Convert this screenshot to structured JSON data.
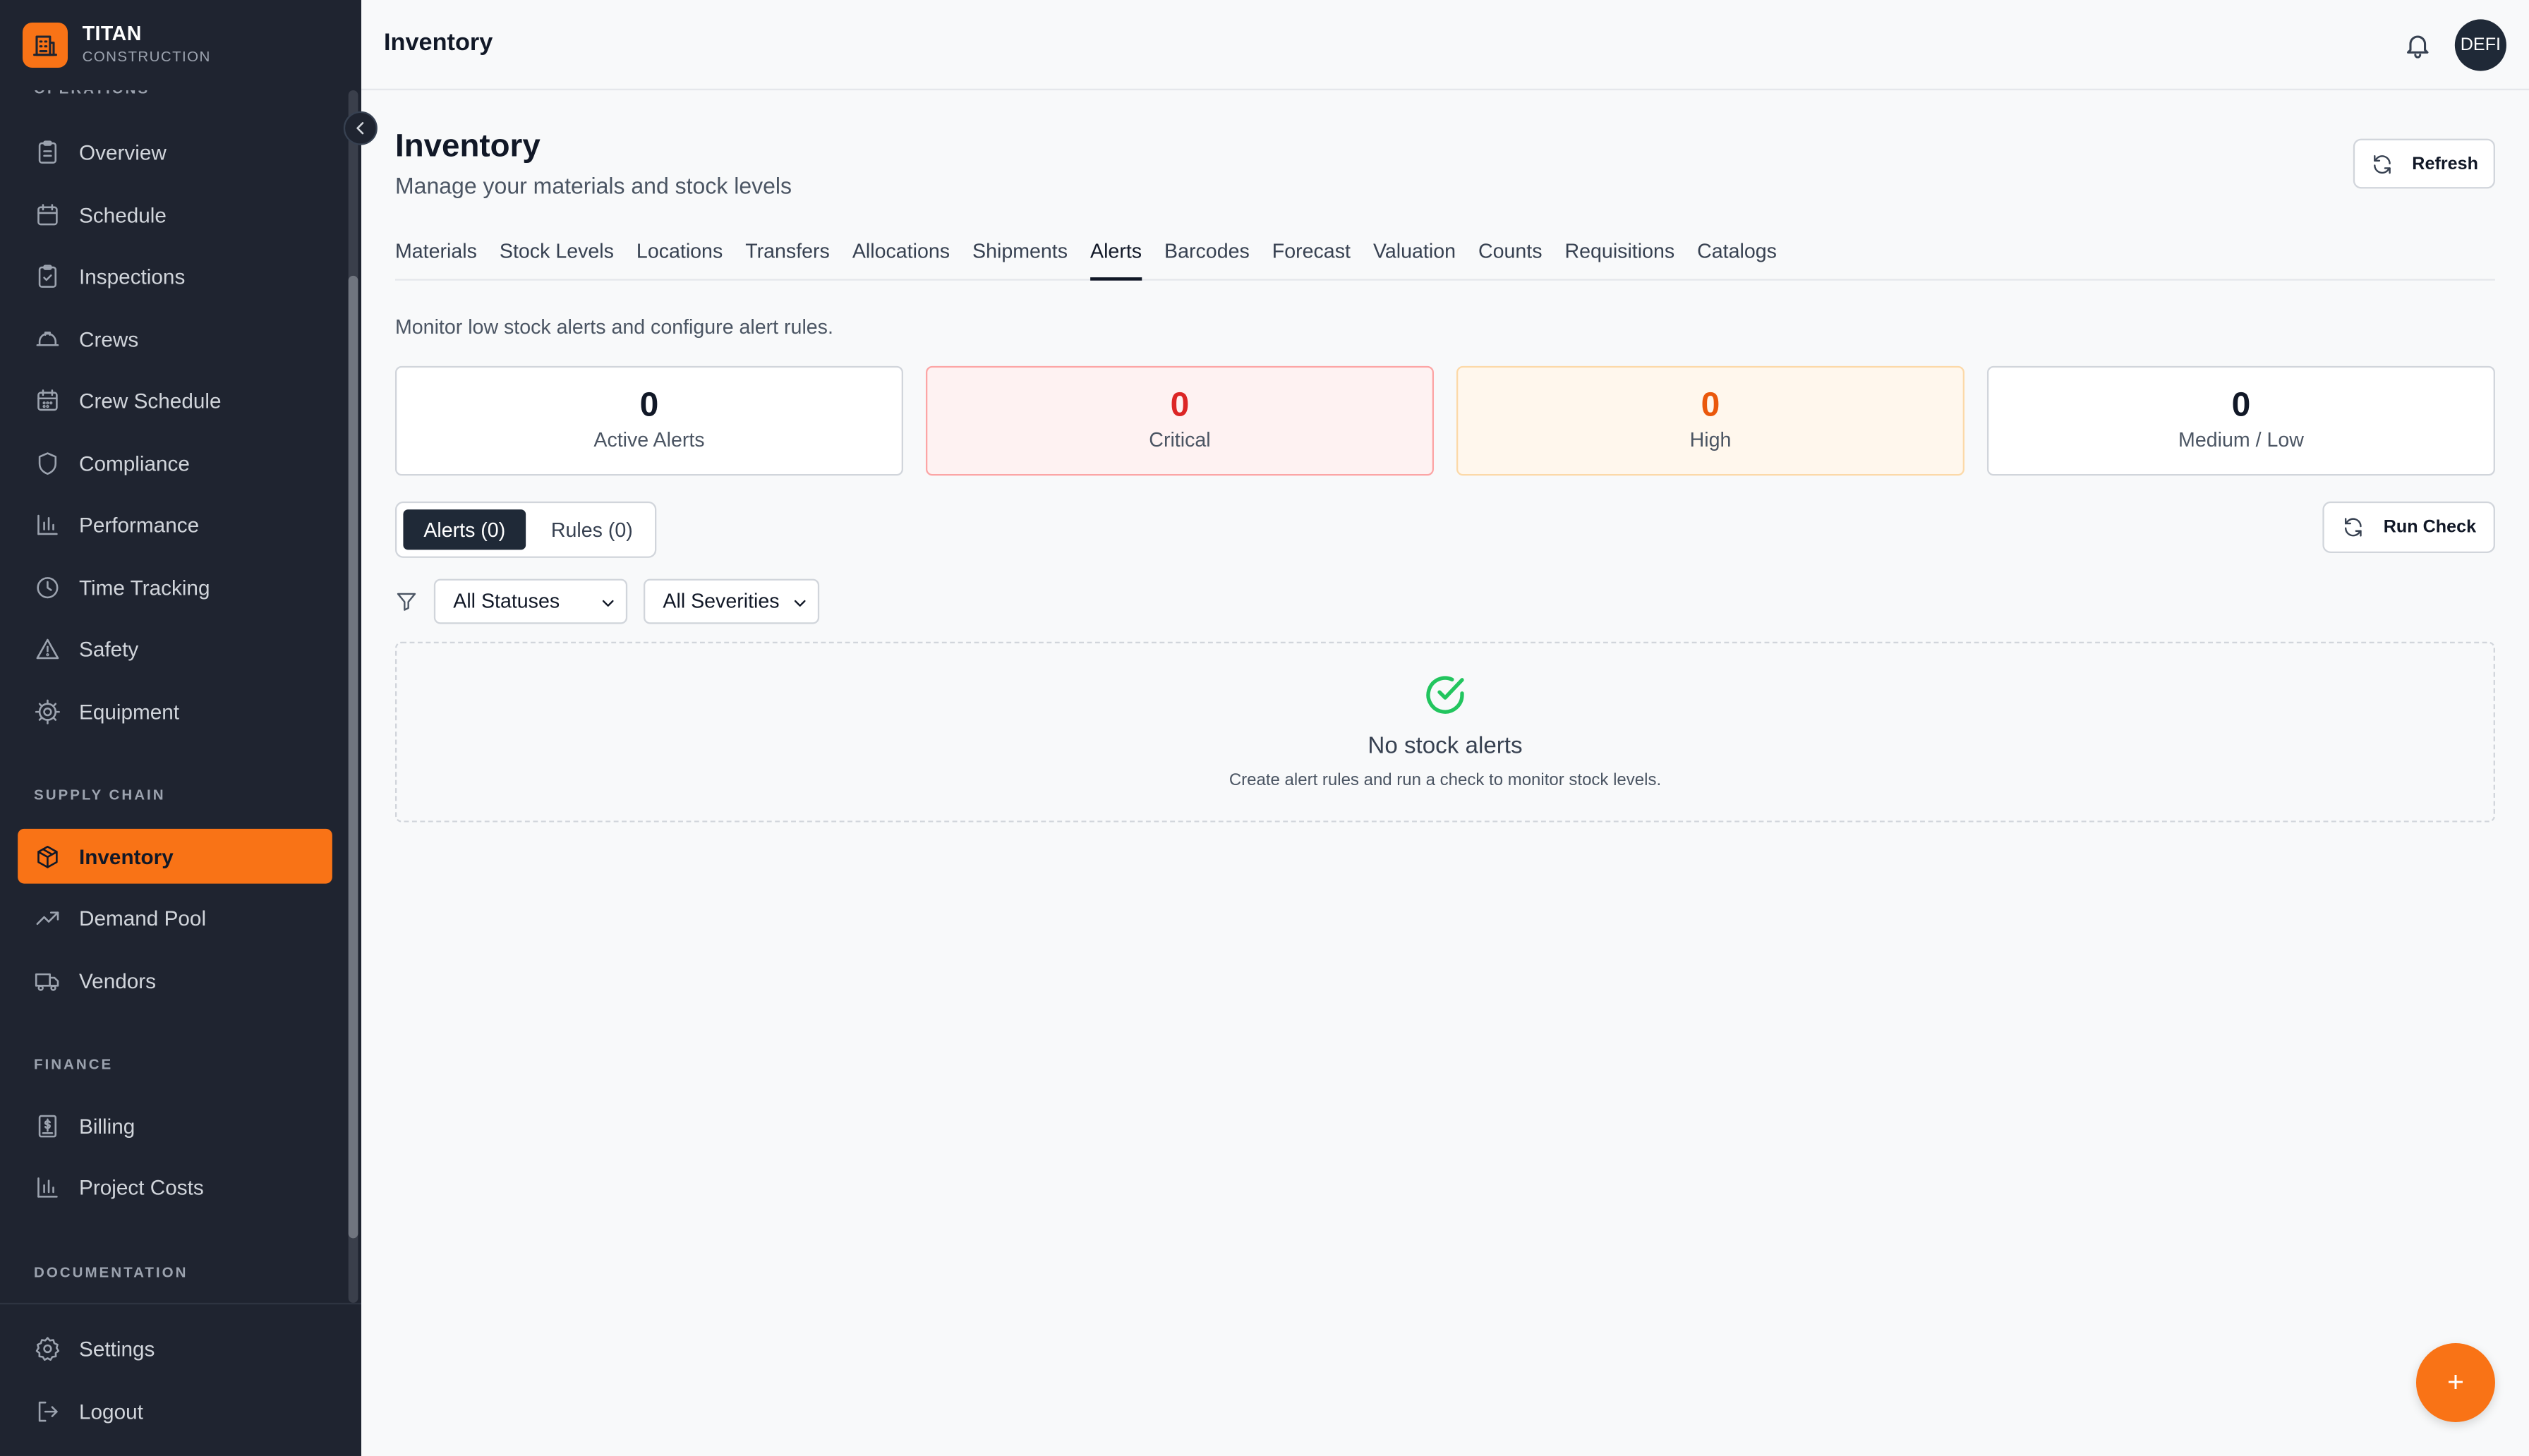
{
  "brand": {
    "name": "TITAN",
    "sub": "CONSTRUCTION"
  },
  "sidebar": {
    "sections": [
      {
        "label": "OPERATIONS"
      },
      {
        "label": "SUPPLY CHAIN"
      },
      {
        "label": "FINANCE"
      },
      {
        "label": "DOCUMENTATION"
      }
    ],
    "items": [
      {
        "label": "Overview",
        "icon": "clipboard-icon"
      },
      {
        "label": "Schedule",
        "icon": "calendar-icon"
      },
      {
        "label": "Inspections",
        "icon": "clipboard-check-icon"
      },
      {
        "label": "Crews",
        "icon": "hard-hat-icon"
      },
      {
        "label": "Crew Schedule",
        "icon": "calendar-grid-icon"
      },
      {
        "label": "Compliance",
        "icon": "shield-icon"
      },
      {
        "label": "Performance",
        "icon": "bar-chart-icon"
      },
      {
        "label": "Time Tracking",
        "icon": "clock-icon"
      },
      {
        "label": "Safety",
        "icon": "warning-icon"
      },
      {
        "label": "Equipment",
        "icon": "cog-icon"
      },
      {
        "label": "Inventory",
        "icon": "package-icon"
      },
      {
        "label": "Demand Pool",
        "icon": "trending-up-icon"
      },
      {
        "label": "Vendors",
        "icon": "truck-icon"
      },
      {
        "label": "Billing",
        "icon": "receipt-icon"
      },
      {
        "label": "Project Costs",
        "icon": "bar-chart-icon"
      },
      {
        "label": "Settings",
        "icon": "settings-icon"
      },
      {
        "label": "Logout",
        "icon": "logout-icon"
      }
    ]
  },
  "header": {
    "title": "Inventory",
    "avatar_text": "DEFI"
  },
  "page": {
    "title": "Inventory",
    "subtitle": "Manage your materials and stock levels",
    "refresh_label": "Refresh"
  },
  "tabs": [
    "Materials",
    "Stock Levels",
    "Locations",
    "Transfers",
    "Allocations",
    "Shipments",
    "Alerts",
    "Barcodes",
    "Forecast",
    "Valuation",
    "Counts",
    "Requisitions",
    "Catalogs"
  ],
  "alerts": {
    "description": "Monitor low stock alerts and configure alert rules.",
    "stats": [
      {
        "value": "0",
        "label": "Active Alerts"
      },
      {
        "value": "0",
        "label": "Critical"
      },
      {
        "value": "0",
        "label": "High"
      },
      {
        "value": "0",
        "label": "Medium / Low"
      }
    ],
    "toggle": {
      "alerts": "Alerts (0)",
      "rules": "Rules (0)"
    },
    "run_check_label": "Run Check",
    "filters": {
      "status": "All Statuses",
      "severity": "All Severities"
    },
    "empty": {
      "title": "No stock alerts",
      "subtitle": "Create alert rules and run a check to monitor stock levels."
    }
  },
  "fab_label": "+",
  "colors": {
    "accent": "#f97316",
    "sidebar_bg": "#1f2430",
    "critical": "#dc2626",
    "high": "#ea580c",
    "success": "#22c55e"
  }
}
